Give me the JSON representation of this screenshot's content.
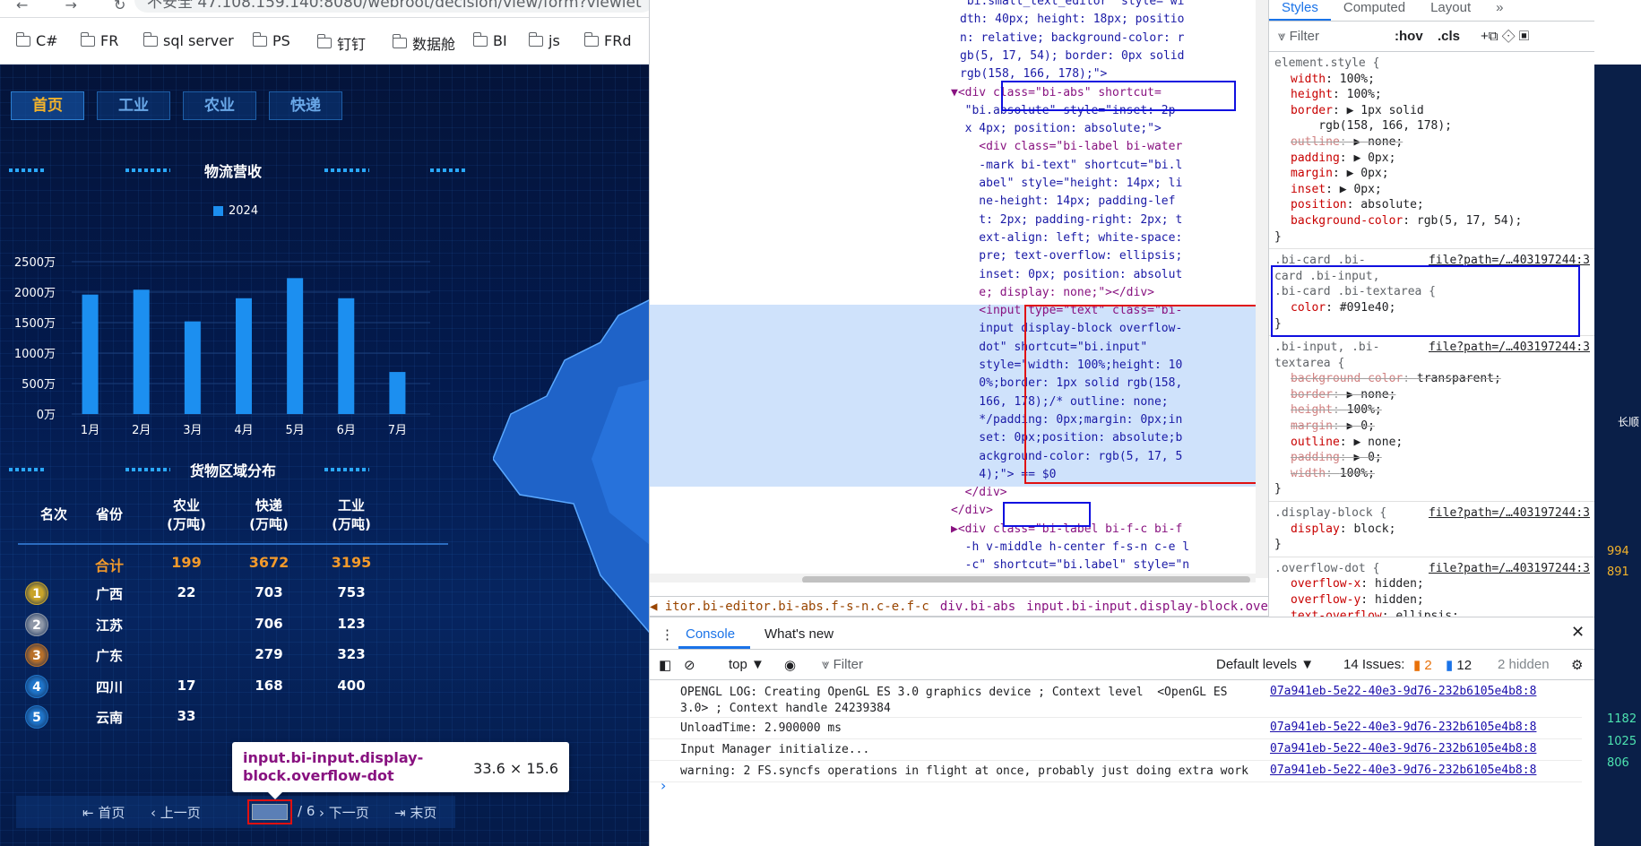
{
  "browser": {
    "nav_icons": "← → ↻",
    "url": "不安全  47.108.159.140:8080/webroot/decision/view/form?viewlet",
    "bookmarks": [
      "C#",
      "FR",
      "sql server",
      "PS",
      "钉钉",
      "数据舱",
      "BI",
      "js",
      "FRd"
    ]
  },
  "dashboard": {
    "tabs": [
      "首页",
      "工业",
      "农业",
      "快递"
    ],
    "chart_title": "物流营收",
    "region_title": "货物区域分布",
    "map_label": "长",
    "chart_data": {
      "type": "bar",
      "title": "物流营收",
      "categories": [
        "1月",
        "2月",
        "3月",
        "4月",
        "5月",
        "6月",
        "7月"
      ],
      "series": [
        {
          "name": "2024",
          "values": [
            1960,
            2040,
            1520,
            1900,
            2230,
            1900,
            690
          ]
        }
      ],
      "ylim": [
        0,
        2500
      ],
      "yticks": [
        "0万",
        "500万",
        "1000万",
        "1500万",
        "2000万",
        "2500万"
      ],
      "color": "#1c8ff0"
    },
    "table": {
      "headers": [
        "名次",
        "省份",
        "农业\n(万吨)",
        "快递\n(万吨)",
        "工业\n(万吨)"
      ],
      "total": {
        "label": "合计",
        "agri": "199",
        "express": "3672",
        "industry": "3195"
      },
      "rows": [
        {
          "rank": "1",
          "province": "广西",
          "agri": "22",
          "express": "703",
          "industry": "753",
          "color": "#c9a42a"
        },
        {
          "rank": "2",
          "province": "江苏",
          "agri": "",
          "express": "706",
          "industry": "123",
          "color": "#8f98a8"
        },
        {
          "rank": "3",
          "province": "广东",
          "agri": "",
          "express": "279",
          "industry": "323",
          "color": "#b8702a"
        },
        {
          "rank": "4",
          "province": "四川",
          "agri": "17",
          "express": "168",
          "industry": "400",
          "color": "#1f74c9"
        },
        {
          "rank": "5",
          "province": "云南",
          "agri": "33",
          "express": "",
          "industry": "",
          "color": "#1f74c9"
        }
      ]
    },
    "pager": {
      "first": "首页",
      "prev": "上一页",
      "total": "/ 6",
      "next": "下一页",
      "last": "末页"
    },
    "tooltip": {
      "selector": "input.bi-input.display-block.overflow-dot",
      "size": "33.6 × 15.6"
    }
  },
  "devtools": {
    "elements_lines": [
      " bi.small_text_editor\" style=\"wi",
      "dth: 40px; height: 18px; positio",
      "n: relative; background-color: r",
      "gb(5, 17, 54); border: 0px solid",
      "rgb(158, 166, 178);\">",
      "▼<div class=\"bi-abs\" shortcut=",
      "  \"bi.absolute\" style=\"inset: 2p",
      "  x 4px; position: absolute;\">",
      "    <div class=\"bi-label bi-water",
      "    -mark bi-text\" shortcut=\"bi.l",
      "    abel\" style=\"height: 14px; li",
      "    ne-height: 14px; padding-lef",
      "    t: 2px; padding-right: 2px; t",
      "    ext-align: left; white-space:",
      "    pre; text-overflow: ellipsis;",
      "    inset: 0px; position: absolut",
      "    e; display: none;\"></div>",
      "    <input type=\"text\" class=\"bi-",
      "    input display-block overflow-",
      "    dot\" shortcut=\"bi.input\"",
      "    style=\"width: 100%;height: 10",
      "    0%;border: 1px solid rgb(158,",
      "    166, 178);/* outline: none;",
      "    */padding: 0px;margin: 0px;in",
      "    set: 0px;position: absolute;b",
      "    ackground-color: rgb(5, 17, 5",
      "    4);\"> == $0",
      "  </div>",
      "</div>",
      "▶<div class=\"bi-label bi-f-c bi-f",
      "  -h v-middle h-center f-s-n c-e l",
      "  -c\" shortcut=\"bi.label\" style=\"n"
    ],
    "breadcrumbs": [
      "◀ itor.bi-editor.bi-abs.f-s-n.c-e.f-c",
      "div.bi-abs",
      "input.bi-input.display-block.overflow-dot",
      "▶"
    ],
    "style_tabs": [
      "Styles",
      "Computed",
      "Layout",
      "»"
    ],
    "filter": {
      "placeholder": "Filter",
      "hov": ":hov",
      ".cls": ".cls"
    },
    "element_style": {
      "selector": "element.style {",
      "props": [
        {
          "n": "width",
          "v": "100%;"
        },
        {
          "n": "height",
          "v": "100%;"
        },
        {
          "n": "border",
          "v": "▶ 1px solid"
        },
        {
          "n": "",
          "v": "    rgb(158, 166, 178);"
        },
        {
          "n": "outline",
          "v": "▶ none;",
          "strike": true
        },
        {
          "n": "padding",
          "v": "▶ 0px;"
        },
        {
          "n": "margin",
          "v": "▶ 0px;"
        },
        {
          "n": "inset",
          "v": "▶ 0px;"
        },
        {
          "n": "position",
          "v": "absolute;"
        },
        {
          "n": "background-color",
          "v": "rgb(5, 17, 54);"
        }
      ]
    },
    "rule2": {
      "sel": ".bi-card .bi-\ncard .bi-input,\n.bi-card .bi-textarea {",
      "link": "file?path=/…403197244:3",
      "props": [
        {
          "n": "color",
          "v": "#091e40;"
        }
      ]
    },
    "rule3": {
      "sel": ".bi-input, .bi-\ntextarea {",
      "link": "file?path=/…403197244:3",
      "props": [
        {
          "n": "background-color",
          "v": "transparent;"
        },
        {
          "n": "border",
          "v": "▶ none;"
        },
        {
          "n": "height",
          "v": "100%;"
        },
        {
          "n": "margin",
          "v": "▶ 0;"
        },
        {
          "n": "outline",
          "v": "▶ none;",
          "ok": true
        },
        {
          "n": "padding",
          "v": "▶ 0;"
        },
        {
          "n": "width",
          "v": "100%;"
        }
      ]
    },
    "rule4": {
      "sel": ".display-block {",
      "link": "file?path=/…403197244:3",
      "props": [
        {
          "n": "display",
          "v": "block;"
        }
      ]
    },
    "rule5": {
      "sel": ".overflow-dot {",
      "link": "file?path=/…403197244:3",
      "props": [
        {
          "n": "overflow-x",
          "v": "hidden;"
        },
        {
          "n": "overflow-y",
          "v": "hidden;"
        },
        {
          "n": "text-overflow",
          "v": "ellipsis;"
        }
      ]
    },
    "console": {
      "tabs": [
        "Console",
        "What's new"
      ],
      "context": "top ▼",
      "filter": "Filter",
      "levels": "Default levels ▼",
      "issues": "14 Issues:",
      "warn": "2",
      "info": "12",
      "hidden": "2 hidden",
      "messages": [
        {
          "text": "OPENGL LOG: Creating OpenGL ES 3.0 graphics device ; Context level  <OpenGL ES\n3.0> ; Context handle 24239384",
          "src": "07a941eb-5e22-40e3-9d76-232b6105e4b8:8"
        },
        {
          "text": "UnloadTime: 2.900000 ms",
          "src": "07a941eb-5e22-40e3-9d76-232b6105e4b8:8"
        },
        {
          "text": "Input Manager initialize...",
          "src": "07a941eb-5e22-40e3-9d76-232b6105e4b8:8"
        },
        {
          "text": "warning: 2 FS.syncfs operations in flight at once, probably just doing extra work",
          "src": "07a941eb-5e22-40e3-9d76-232b6105e4b8:8"
        }
      ]
    }
  },
  "strip": {
    "values": [
      "994",
      "891",
      "1182",
      "1025",
      "806"
    ],
    "label": "长顺"
  }
}
